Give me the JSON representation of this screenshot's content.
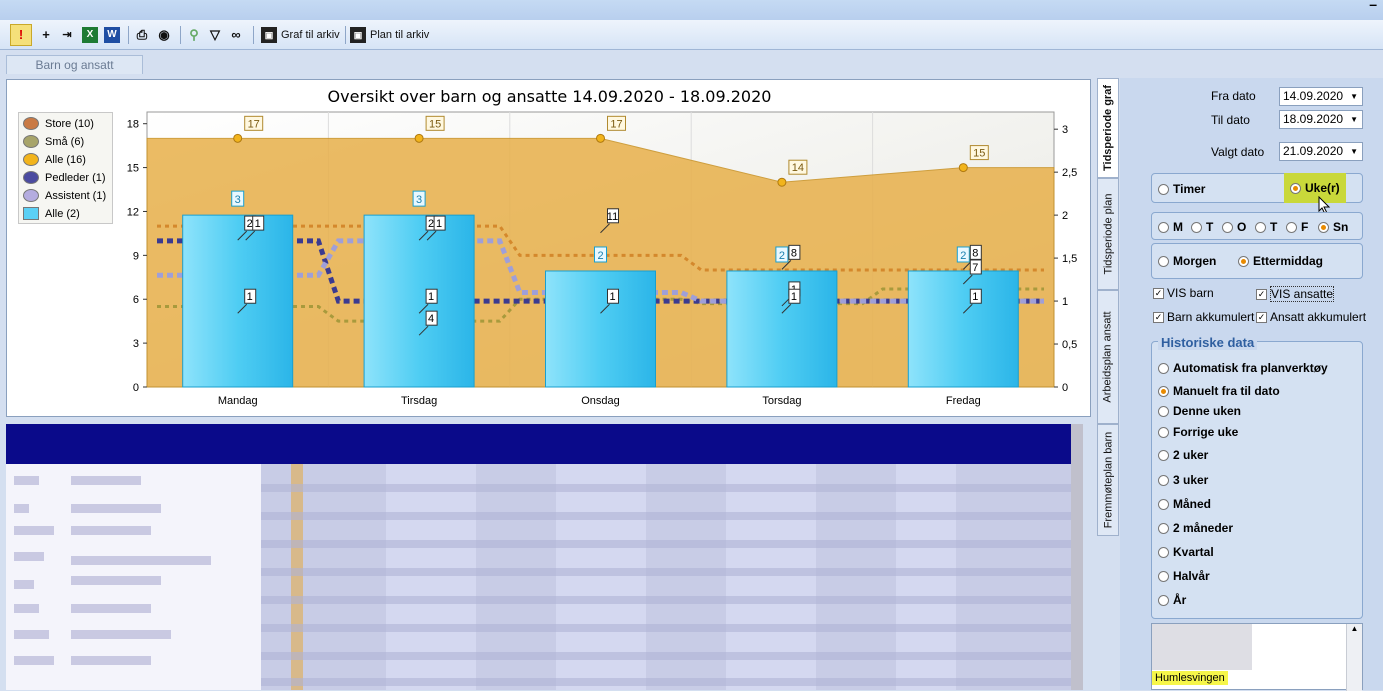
{
  "toolbar": {
    "graf_til_arkiv": "Graf til arkiv",
    "plan_til_arkiv": "Plan til arkiv",
    "icons": [
      "alert-icon",
      "add-icon",
      "indent-icon",
      "excel-icon",
      "word-icon",
      "print-icon",
      "preview-icon",
      "filter-clear-icon",
      "filter-icon",
      "binoculars-icon",
      "save-icon",
      "save-icon"
    ]
  },
  "tabs": {
    "barn_og_ansatt": "Barn og ansatt"
  },
  "chart_data": {
    "type": "bar",
    "title": "Oversikt over barn og ansatte 14.09.2020 - 18.09.2020",
    "categories": [
      "Mandag",
      "Tirsdag",
      "Onsdag",
      "Torsdag",
      "Fredag"
    ],
    "ylim_left": [
      0,
      18
    ],
    "yticks_left": [
      "0",
      "3",
      "6",
      "9",
      "12",
      "15",
      "18"
    ],
    "ylim_right": [
      0,
      3.2
    ],
    "yticks_right": [
      "0",
      "0,5",
      "1",
      "1,5",
      "2",
      "2,5",
      "3"
    ],
    "legend": [
      "Store (10)",
      "Små (6)",
      "Alle (16)",
      "Pedleder (1)",
      "Assistent (1)",
      "Alle (2)"
    ],
    "series": [
      {
        "name": "Alle (16)",
        "axis": "left",
        "type": "area",
        "values": [
          17,
          17,
          17,
          14,
          15
        ],
        "labels": [
          "17",
          "15",
          "17",
          "14",
          "15"
        ],
        "color": "#e8b04a"
      },
      {
        "name": "Alle (2)",
        "axis": "right",
        "type": "bar",
        "values": [
          2,
          2,
          1.35,
          1.35,
          1.35
        ],
        "labels": [
          "3",
          "3",
          "2",
          "2",
          "2"
        ],
        "color": "#3fc3ef"
      },
      {
        "name": "Store (10)",
        "axis": "left",
        "type": "line",
        "values": [
          11,
          11,
          9,
          8,
          8
        ],
        "labels": [
          "2",
          "2",
          "",
          "8",
          "8"
        ],
        "color": "#d4882c"
      },
      {
        "name": "Små (6)",
        "axis": "left",
        "type": "line",
        "values": [
          5.5,
          4.5,
          6,
          5.7,
          6.7
        ],
        "labels": [
          "1",
          "4",
          "1",
          "1",
          "7"
        ],
        "color": "#a89a3c"
      },
      {
        "name": "Pedleder (1)",
        "axis": "right",
        "type": "line",
        "values": [
          1.7,
          1,
          1,
          1,
          1
        ],
        "labels": [
          "1",
          "1",
          "",
          "",
          ""
        ],
        "color": "#3b3b90"
      },
      {
        "name": "Assistent (1)",
        "axis": "right",
        "type": "line",
        "values": [
          1.3,
          1.7,
          1.1,
          1,
          1
        ],
        "labels": [
          "1",
          "1",
          "",
          "",
          ""
        ],
        "color": "#9f9fd8"
      }
    ],
    "colors": {
      "store": "#c97a45",
      "sma": "#a7a46a",
      "alle16": "#f2b41c",
      "pedleder": "#4b4ba0",
      "assistent": "#b4acdf",
      "alle2": "#5bd0f5"
    }
  },
  "sidetabs": [
    "Tidsperiode graf",
    "Tidsperiode plan",
    "Arbeidsplan ansatt",
    "Fremmøteplan barn"
  ],
  "right": {
    "fra_dato_label": "Fra dato",
    "fra_dato": "14.09.2020",
    "til_dato_label": "Til dato",
    "til_dato": "18.09.2020",
    "valgt_dato_label": "Valgt dato",
    "valgt_dato": "21.09.2020",
    "timer": "Timer",
    "uker": "Uke(r)",
    "days": [
      "M",
      "T",
      "O",
      "T",
      "F",
      "Sn"
    ],
    "morgen": "Morgen",
    "ettermiddag": "Ettermiddag",
    "vis_barn": "VIS barn",
    "vis_ansatte": "VIS ansatte",
    "barn_akkumulert": "Barn akkumulert",
    "ansatt_akkumulert": "Ansatt akkumulert",
    "historiske_data": "Historiske data",
    "hist_options": [
      "Automatisk fra planverktøy",
      "Manuelt fra til dato",
      "Denne uken",
      "Forrige uke",
      "2 uker",
      "3 uker",
      "Måned",
      "2 måneder",
      "Kvartal",
      "Halvår",
      "År"
    ],
    "list_item": "Humlesvingen"
  }
}
